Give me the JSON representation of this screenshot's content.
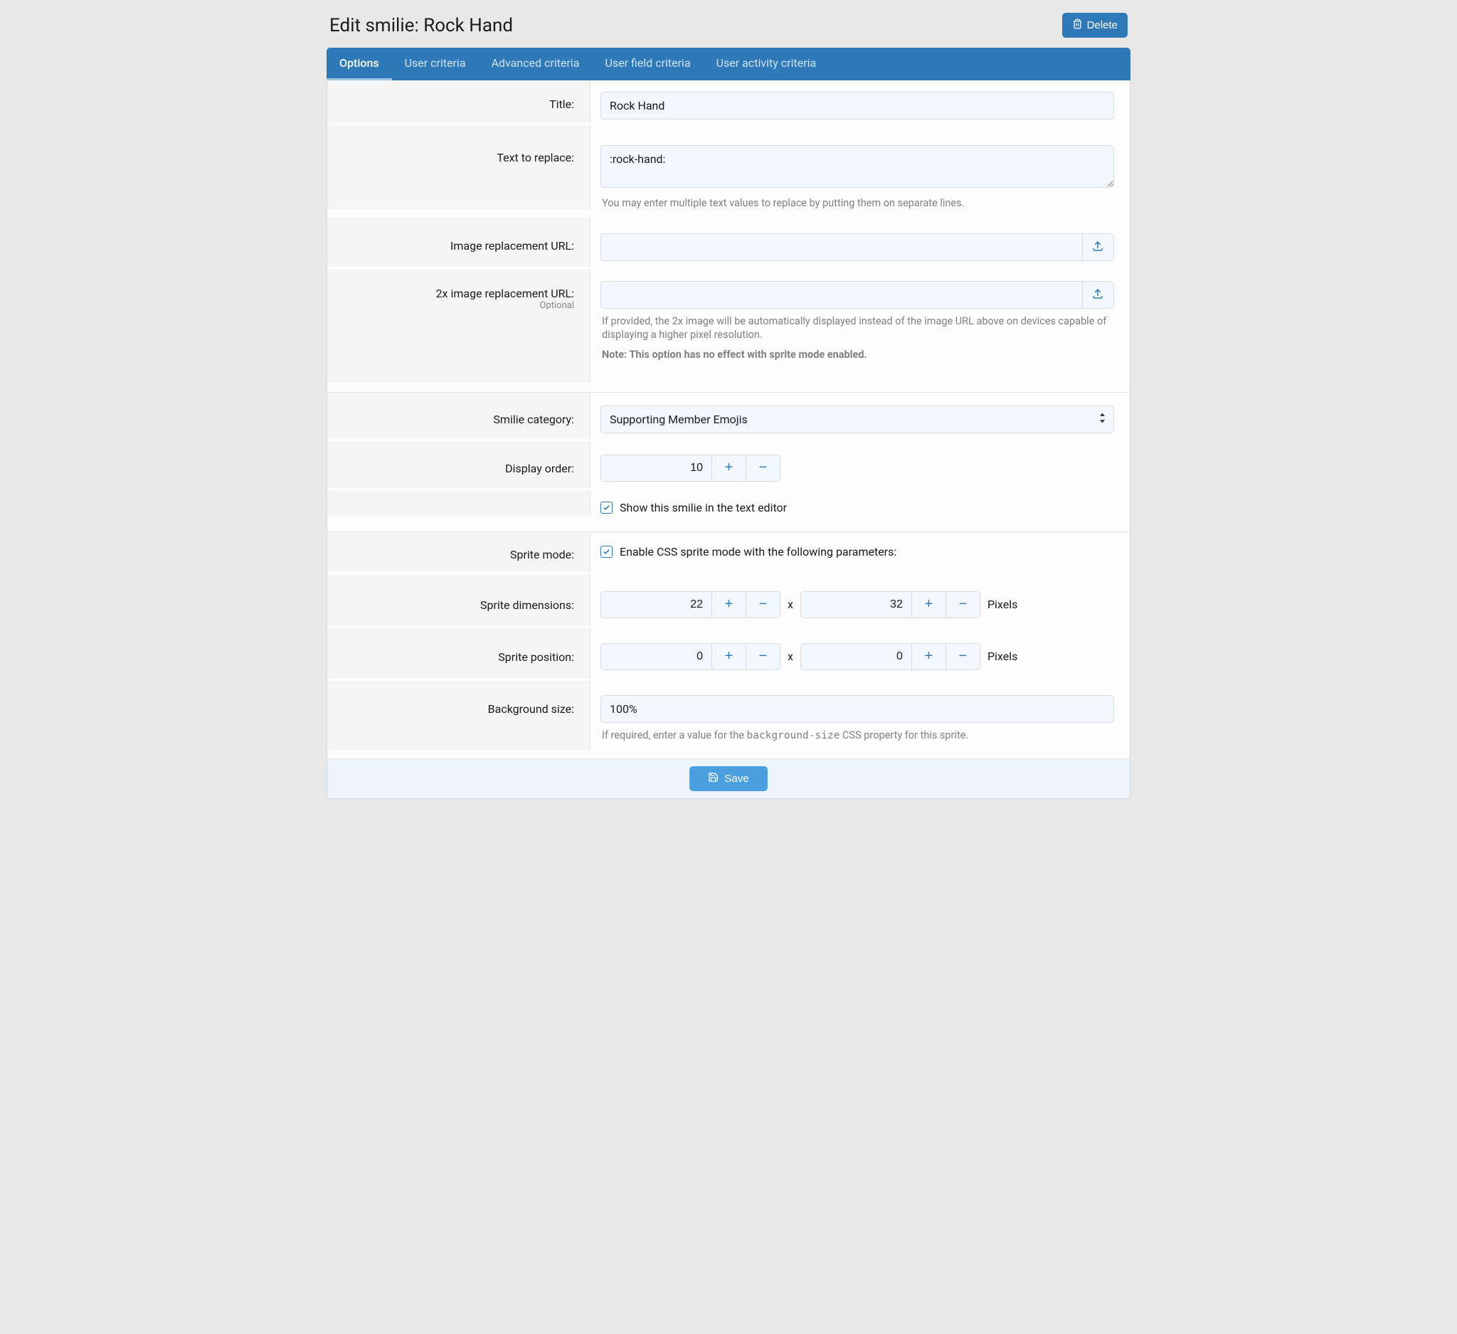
{
  "header": {
    "title": "Edit smilie: Rock Hand",
    "delete_label": "Delete"
  },
  "tabs": [
    {
      "label": "Options",
      "active": true
    },
    {
      "label": "User criteria",
      "active": false
    },
    {
      "label": "Advanced criteria",
      "active": false
    },
    {
      "label": "User field criteria",
      "active": false
    },
    {
      "label": "User activity criteria",
      "active": false
    }
  ],
  "fields": {
    "title_label": "Title:",
    "title_value": "Rock Hand",
    "text_to_replace_label": "Text to replace:",
    "text_to_replace_value": ":rock-hand:",
    "text_to_replace_hint": "You may enter multiple text values to replace by putting them on separate lines.",
    "image_url_label": "Image replacement URL:",
    "image_url_value": "",
    "image2x_url_label": "2x image replacement URL:",
    "image2x_optional": "Optional",
    "image2x_url_value": "",
    "image2x_hint_line1": "If provided, the 2x image will be automatically displayed instead of the image URL above on devices capable of displaying a higher pixel resolution.",
    "image2x_hint_note": "Note: This option has no effect with sprite mode enabled.",
    "category_label": "Smilie category:",
    "category_value": "Supporting Member Emojis",
    "display_order_label": "Display order:",
    "display_order_value": "10",
    "show_in_editor_label": "Show this smilie in the text editor",
    "sprite_mode_label": "Sprite mode:",
    "sprite_mode_check_label": "Enable CSS sprite mode with the following parameters:",
    "sprite_dimensions_label": "Sprite dimensions:",
    "sprite_width": "22",
    "sprite_height": "32",
    "sprite_position_label": "Sprite position:",
    "sprite_pos_x": "0",
    "sprite_pos_y": "0",
    "pixels_unit": "Pixels",
    "x_sep": "x",
    "bg_size_label": "Background size:",
    "bg_size_value": "100%",
    "bg_size_hint_a": "If required, enter a value for the ",
    "bg_size_hint_code": "background-size",
    "bg_size_hint_b": " CSS property for this sprite."
  },
  "footer": {
    "save_label": "Save"
  }
}
